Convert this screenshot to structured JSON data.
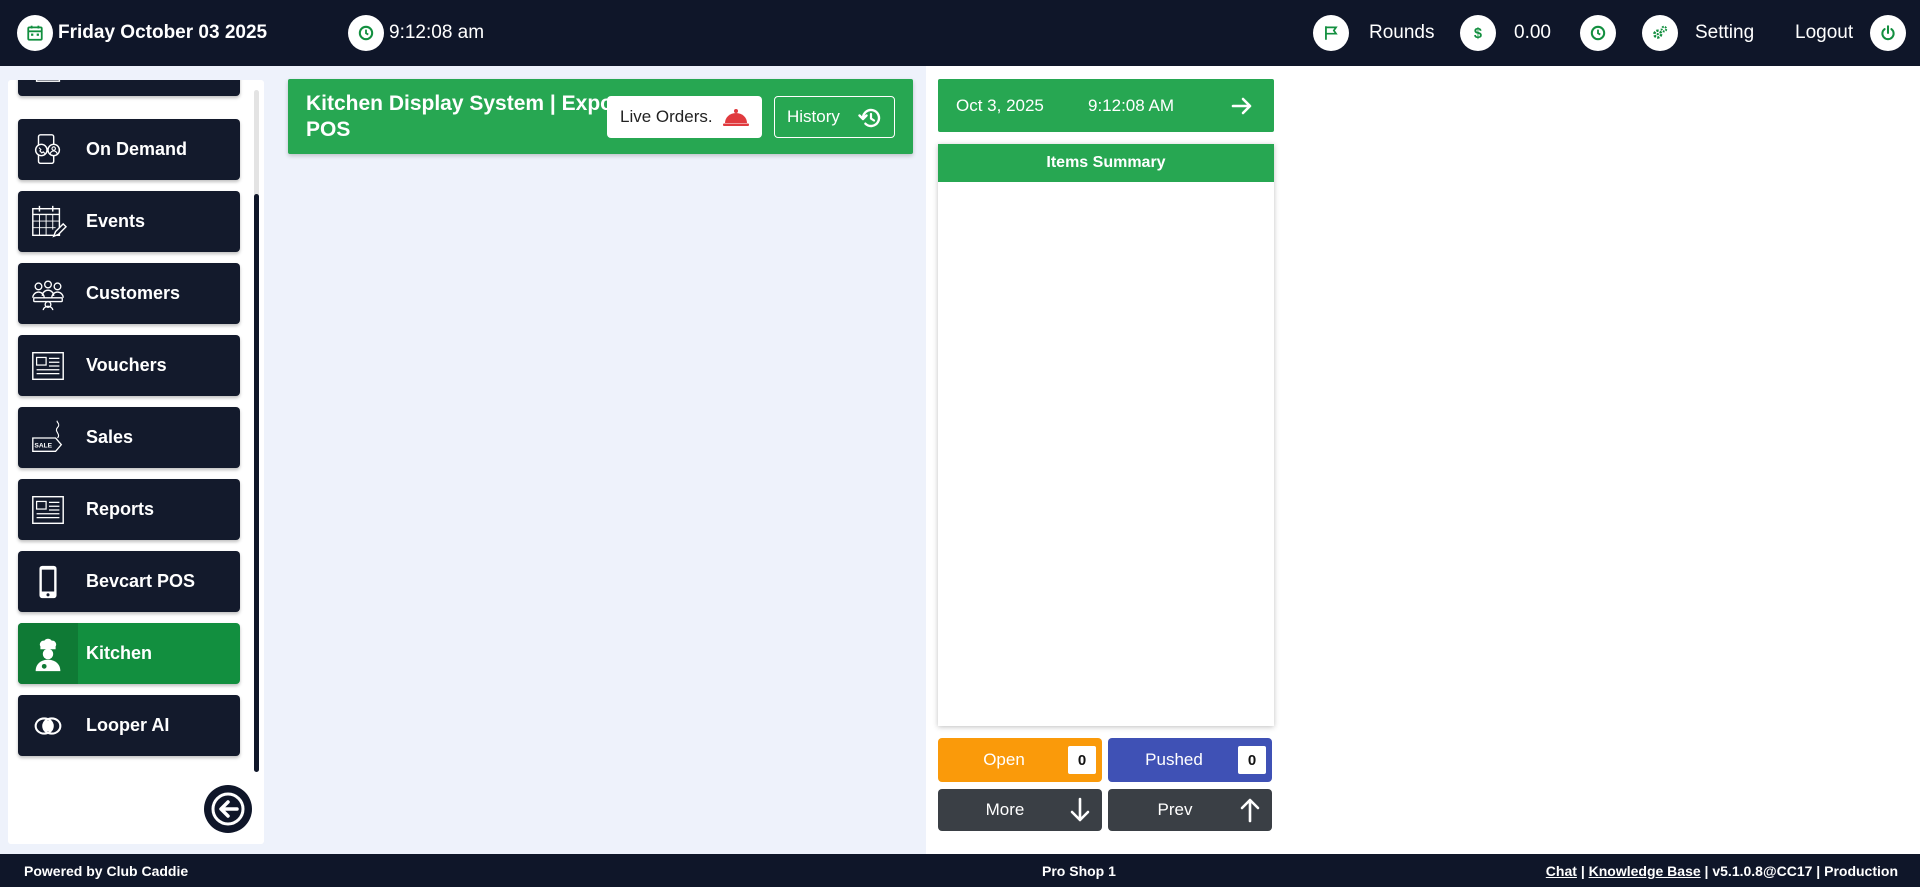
{
  "topbar": {
    "date": "Friday October 03 2025",
    "time": "9:12:08 am",
    "rounds_label": "Rounds",
    "amount": "0.00",
    "setting_label": "Setting",
    "logout_label": "Logout"
  },
  "sidebar": {
    "items": [
      {
        "label": "On Demand",
        "icon": "phone-support-icon",
        "active": false
      },
      {
        "label": "Events",
        "icon": "calendar-edit-icon",
        "active": false
      },
      {
        "label": "Customers",
        "icon": "customers-icon",
        "active": false
      },
      {
        "label": "Vouchers",
        "icon": "voucher-icon",
        "active": false
      },
      {
        "label": "Sales",
        "icon": "sale-tag-icon",
        "active": false
      },
      {
        "label": "Reports",
        "icon": "report-icon",
        "active": false
      },
      {
        "label": "Bevcart POS",
        "icon": "mobile-icon",
        "active": false
      },
      {
        "label": "Kitchen",
        "icon": "chef-icon",
        "active": true
      },
      {
        "label": "Looper AI",
        "icon": "looper-icon",
        "active": false
      }
    ]
  },
  "kds": {
    "title": "Kitchen Display System | Expo POS",
    "live_orders_label": "Live Orders.",
    "history_label": "History"
  },
  "right_panel": {
    "date": "Oct 3, 2025",
    "time": "9:12:08 AM",
    "summary_title": "Items Summary",
    "open_label": "Open",
    "open_count": "0",
    "pushed_label": "Pushed",
    "pushed_count": "0",
    "more_label": "More",
    "prev_label": "Prev"
  },
  "footer": {
    "powered_by": "Powered by Club Caddie",
    "location": "Pro Shop 1",
    "chat_link": "Chat",
    "separator": "|",
    "kb_link": "Knowledge Base",
    "version": "v5.1.0.8@CC17",
    "environment": "Production"
  },
  "colors": {
    "navy": "#0f1629",
    "green": "#27a752",
    "active_green": "#128f3f",
    "open_orange": "#fa9a0a",
    "pushed_blue": "#3f51b5",
    "nav_gray": "#3a3f45",
    "alert_red": "#e03a3e"
  }
}
